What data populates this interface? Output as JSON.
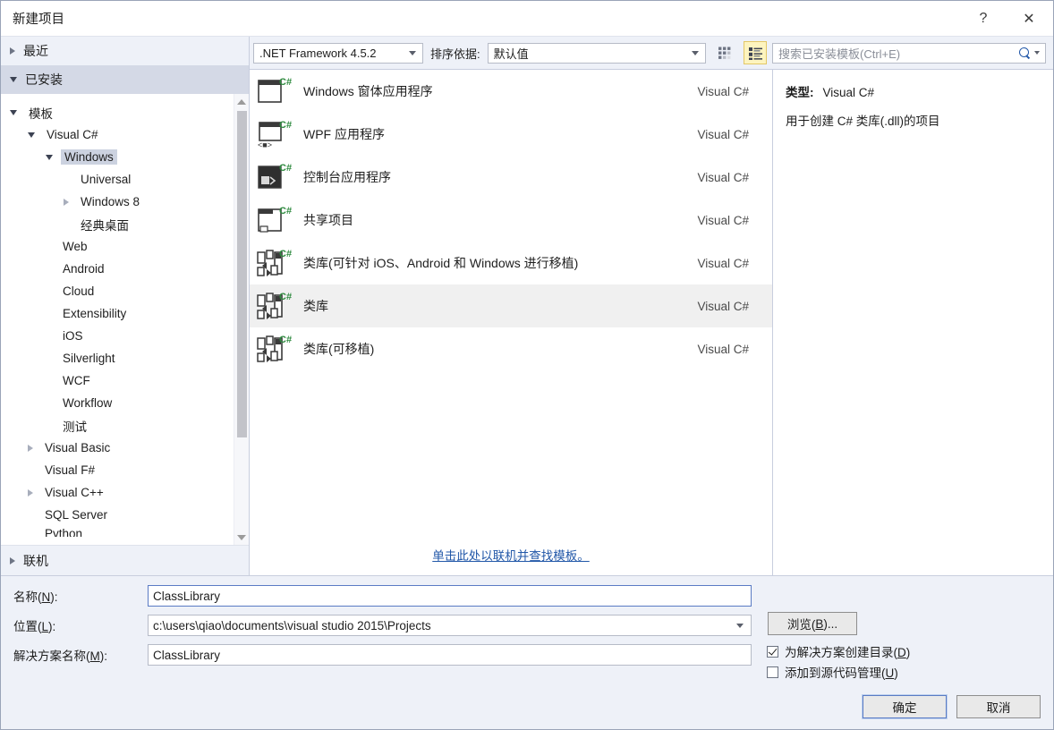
{
  "window": {
    "title": "新建项目",
    "help_button": "?",
    "close_button": "✕"
  },
  "sidebar": {
    "recent": "最近",
    "installed": "已安装",
    "online": "联机",
    "tree": [
      {
        "label": "模板",
        "indent": 0,
        "state": "expanded",
        "selected": false
      },
      {
        "label": "Visual C#",
        "indent": 1,
        "state": "expanded",
        "selected": false
      },
      {
        "label": "Windows",
        "indent": 2,
        "state": "expanded",
        "selected": true
      },
      {
        "label": "Universal",
        "indent": 3,
        "state": "leaf",
        "selected": false
      },
      {
        "label": "Windows 8",
        "indent": 3,
        "state": "collapsed",
        "selected": false
      },
      {
        "label": "经典桌面",
        "indent": 3,
        "state": "leaf",
        "selected": false
      },
      {
        "label": "Web",
        "indent": 2,
        "state": "leaf",
        "selected": false
      },
      {
        "label": "Android",
        "indent": 2,
        "state": "leaf",
        "selected": false
      },
      {
        "label": "Cloud",
        "indent": 2,
        "state": "leaf",
        "selected": false
      },
      {
        "label": "Extensibility",
        "indent": 2,
        "state": "leaf",
        "selected": false
      },
      {
        "label": "iOS",
        "indent": 2,
        "state": "leaf",
        "selected": false
      },
      {
        "label": "Silverlight",
        "indent": 2,
        "state": "leaf",
        "selected": false
      },
      {
        "label": "WCF",
        "indent": 2,
        "state": "leaf",
        "selected": false
      },
      {
        "label": "Workflow",
        "indent": 2,
        "state": "leaf",
        "selected": false
      },
      {
        "label": "测试",
        "indent": 2,
        "state": "leaf",
        "selected": false
      },
      {
        "label": "Visual Basic",
        "indent": 1,
        "state": "collapsed",
        "selected": false
      },
      {
        "label": "Visual F#",
        "indent": 1,
        "state": "leaf",
        "selected": false
      },
      {
        "label": "Visual C++",
        "indent": 1,
        "state": "collapsed",
        "selected": false
      },
      {
        "label": "SQL Server",
        "indent": 1,
        "state": "leaf",
        "selected": false
      },
      {
        "label": "Python",
        "indent": 1,
        "state": "leaf",
        "selected": false,
        "clipped": true
      }
    ]
  },
  "toolbar": {
    "framework": ".NET Framework 4.5.2",
    "sort_label": "排序依据:",
    "sort_value": "默认值",
    "view_small_icons": "small-icons-view",
    "view_list": "list-view",
    "active_view": "list"
  },
  "search": {
    "placeholder": "搜索已安装模板(Ctrl+E)",
    "value": ""
  },
  "templates": {
    "online_link": "单击此处以联机并查找模板。",
    "items": [
      {
        "name": "Windows 窗体应用程序",
        "language": "Visual C#",
        "icon": "winforms-icon",
        "selected": false
      },
      {
        "name": "WPF 应用程序",
        "language": "Visual C#",
        "icon": "wpf-icon",
        "selected": false
      },
      {
        "name": "控制台应用程序",
        "language": "Visual C#",
        "icon": "console-icon",
        "selected": false
      },
      {
        "name": "共享项目",
        "language": "Visual C#",
        "icon": "shared-project-icon",
        "selected": false
      },
      {
        "name": "类库(可针对 iOS、Android 和 Windows 进行移植)",
        "language": "Visual C#",
        "icon": "class-library-icon",
        "selected": false
      },
      {
        "name": "类库",
        "language": "Visual C#",
        "icon": "class-library-icon",
        "selected": true
      },
      {
        "name": "类库(可移植)",
        "language": "Visual C#",
        "icon": "class-library-icon",
        "selected": false
      }
    ]
  },
  "description": {
    "type_label": "类型:",
    "type_value": "Visual C#",
    "text": "用于创建 C# 类库(.dll)的项目"
  },
  "form": {
    "name_label": "名称(N):",
    "name_value": "ClassLibrary",
    "location_label": "位置(L):",
    "location_value": "c:\\users\\qiao\\documents\\visual studio 2015\\Projects",
    "solution_label": "解决方案名称(M):",
    "solution_value": "ClassLibrary",
    "browse_button": "浏览(B)...",
    "create_dir_checkbox": "为解决方案创建目录(D)",
    "create_dir_checked": true,
    "source_control_checkbox": "添加到源代码管理(U)",
    "source_control_checked": false,
    "ok_button": "确定",
    "cancel_button": "取消"
  },
  "colors": {
    "dialog_bg": "#eef1f8",
    "panel_bg": "#ffffff",
    "selection": "#ccd2e0",
    "row_selection": "#f0f0f0",
    "link": "#2157a8",
    "accent_yellow": "#fdf4bf",
    "csharp_green": "#2d8a3e"
  }
}
